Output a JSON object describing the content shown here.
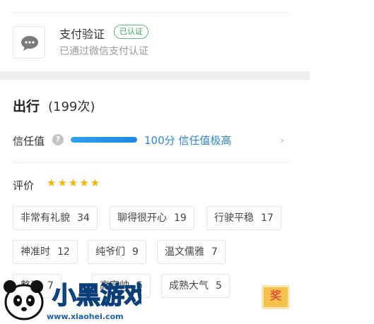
{
  "payment": {
    "title": "支付验证",
    "badge": "已认证",
    "subtitle": "已通过微信支付认证",
    "icon": "wechat-chat-icon"
  },
  "trips": {
    "title": "出行",
    "count": "(199次)"
  },
  "trust": {
    "label": "信任值",
    "level_fraction": 1.0,
    "text": "100分 信任值极高"
  },
  "evaluation": {
    "label": "评价",
    "stars": "★★★★★",
    "rating": 5
  },
  "tags": [
    {
      "label": "非常有礼貌",
      "count": "34"
    },
    {
      "label": "聊得很开心",
      "count": "19"
    },
    {
      "label": "行驶平稳",
      "count": "17"
    },
    {
      "label": "神准时",
      "count": "12"
    },
    {
      "label": "纯爷们",
      "count": "9"
    },
    {
      "label": "温文儒雅",
      "count": "7"
    },
    {
      "label": "整洁",
      "count": "7"
    },
    {
      "label": "高富帅",
      "count": "5"
    },
    {
      "label": "成熟大气",
      "count": "5"
    }
  ],
  "watermark": {
    "brand": "小黑游戏",
    "url": "www.xiaohei.com"
  },
  "reward_icon": "奖",
  "colors": {
    "accent_blue": "#2f86de",
    "badge_green": "#35a85a",
    "star_gold": "#f5b500"
  }
}
